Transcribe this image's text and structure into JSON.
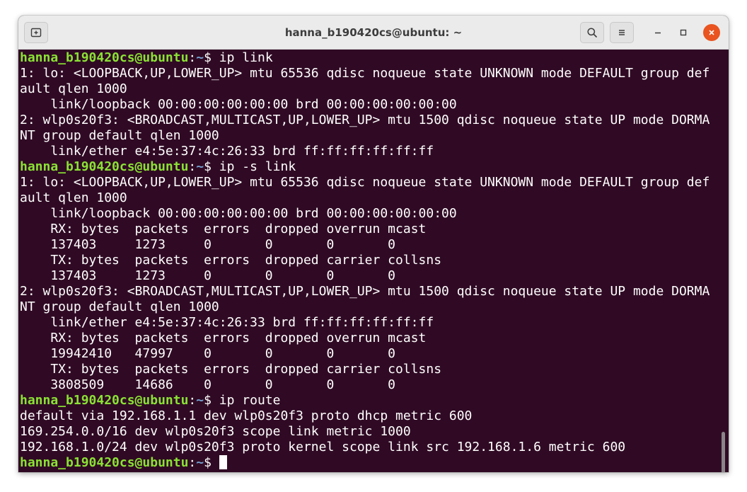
{
  "window": {
    "title": "hanna_b190420cs@ubuntu: ~"
  },
  "prompt": {
    "user_host": "hanna_b190420cs@ubuntu",
    "sep": ":",
    "path": "~",
    "symbol": "$ "
  },
  "commands": {
    "c1": "ip link",
    "c2": "ip -s link",
    "c3": "ip route"
  },
  "output": {
    "l1": "1: lo: <LOOPBACK,UP,LOWER_UP> mtu 65536 qdisc noqueue state UNKNOWN mode DEFAULT group def",
    "l2": "ault qlen 1000",
    "l3": "    link/loopback 00:00:00:00:00:00 brd 00:00:00:00:00:00",
    "l4": "2: wlp0s20f3: <BROADCAST,MULTICAST,UP,LOWER_UP> mtu 1500 qdisc noqueue state UP mode DORMA",
    "l5": "NT group default qlen 1000",
    "l6": "    link/ether e4:5e:37:4c:26:33 brd ff:ff:ff:ff:ff:ff",
    "l7": "1: lo: <LOOPBACK,UP,LOWER_UP> mtu 65536 qdisc noqueue state UNKNOWN mode DEFAULT group def",
    "l8": "ault qlen 1000",
    "l9": "    link/loopback 00:00:00:00:00:00 brd 00:00:00:00:00:00",
    "l10": "    RX: bytes  packets  errors  dropped overrun mcast",
    "l11": "    137403     1273     0       0       0       0",
    "l12": "    TX: bytes  packets  errors  dropped carrier collsns",
    "l13": "    137403     1273     0       0       0       0",
    "l14": "2: wlp0s20f3: <BROADCAST,MULTICAST,UP,LOWER_UP> mtu 1500 qdisc noqueue state UP mode DORMA",
    "l15": "NT group default qlen 1000",
    "l16": "    link/ether e4:5e:37:4c:26:33 brd ff:ff:ff:ff:ff:ff",
    "l17": "    RX: bytes  packets  errors  dropped overrun mcast",
    "l18": "    19942410   47997    0       0       0       0",
    "l19": "    TX: bytes  packets  errors  dropped carrier collsns",
    "l20": "    3808509    14686    0       0       0       0",
    "l21": "default via 192.168.1.1 dev wlp0s20f3 proto dhcp metric 600",
    "l22": "169.254.0.0/16 dev wlp0s20f3 scope link metric 1000",
    "l23": "192.168.1.0/24 dev wlp0s20f3 proto kernel scope link src 192.168.1.6 metric 600"
  },
  "icons": {
    "new_tab": "new-tab-icon",
    "search": "search-icon",
    "menu": "hamburger-menu-icon",
    "minimize": "minimize-icon",
    "maximize": "maximize-icon",
    "close": "close-icon"
  },
  "colors": {
    "terminal_bg": "#300a24",
    "prompt_user": "#8ae234",
    "prompt_path": "#729fcf",
    "close_button": "#e95420"
  }
}
